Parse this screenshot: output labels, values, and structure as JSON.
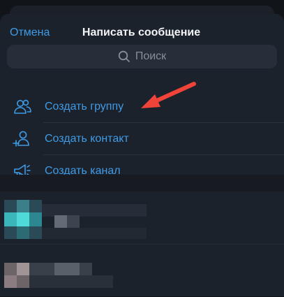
{
  "header": {
    "cancel_label": "Отмена",
    "title": "Написать сообщение"
  },
  "search": {
    "placeholder": "Поиск",
    "icon": "search-icon"
  },
  "menu": {
    "items": [
      {
        "label": "Создать группу",
        "icon": "group-icon"
      },
      {
        "label": "Создать контакт",
        "icon": "add-contact-icon"
      },
      {
        "label": "Создать канал",
        "icon": "megaphone-icon"
      }
    ]
  },
  "annotation": {
    "icon": "red-arrow-icon",
    "color": "#f0433a"
  },
  "colors": {
    "accent": "#3f9be6",
    "background": "#1c222b",
    "title": "#f2f4f7",
    "placeholder": "#868e99"
  }
}
